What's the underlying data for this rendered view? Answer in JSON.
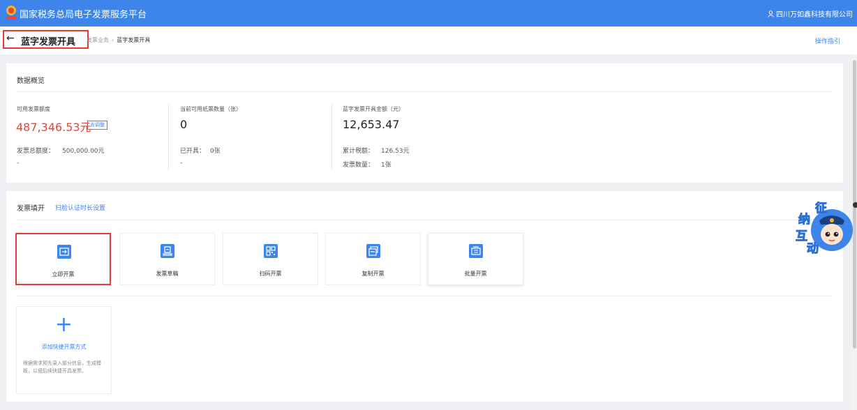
{
  "topbar": {
    "title": "国家税务总局电子发票服务平台",
    "user": "四川万如鑫科技有限公司"
  },
  "header": {
    "page_title": "蓝字发票开具",
    "breadcrumb": [
      "发票业务",
      "蓝字发票开具"
    ],
    "breadcrumb_sep": "›",
    "guide_link": "操作指引"
  },
  "overview": {
    "title": "数据概览",
    "col1": {
      "label": "可用发票额度",
      "value": "487,346.53元",
      "adjust_button": "去调整",
      "total_label": "发票总额度：",
      "total_value": "500,000.00元",
      "dash": "-"
    },
    "col2": {
      "label": "当前可用纸票数量（张）",
      "value": "0",
      "issued_label": "已开具：",
      "issued_value": "0张",
      "dash": "-"
    },
    "col3": {
      "label": "蓝字发票开具金额（元）",
      "value": "12,653.47",
      "tax_label": "累计税额：",
      "tax_value": "126.53元",
      "count_label": "发票数量：",
      "count_value": "1张"
    }
  },
  "fill": {
    "title": "发票填开",
    "scan_setting_link": "扫脸认证时长设置",
    "tiles": [
      {
        "label": "立即开票",
        "icon": "issue-now-icon"
      },
      {
        "label": "发票草稿",
        "icon": "draft-icon"
      },
      {
        "label": "扫码开票",
        "icon": "qrcode-icon"
      },
      {
        "label": "复制开票",
        "icon": "copy-invoice-icon"
      },
      {
        "label": "批量开票",
        "icon": "batch-invoice-icon"
      }
    ],
    "add_shortcut": {
      "plus": "+",
      "title": "添加快捷开票方式",
      "desc": "根据需求预先录入部分信息，生成模板，以便后续快捷开具发票。"
    }
  },
  "mascot": {
    "chars": [
      "征",
      "纳",
      "互",
      "动"
    ]
  },
  "colors": {
    "primary": "#3d85ea",
    "accent_red": "#e8443b",
    "highlight_border": "#e33a3a"
  }
}
